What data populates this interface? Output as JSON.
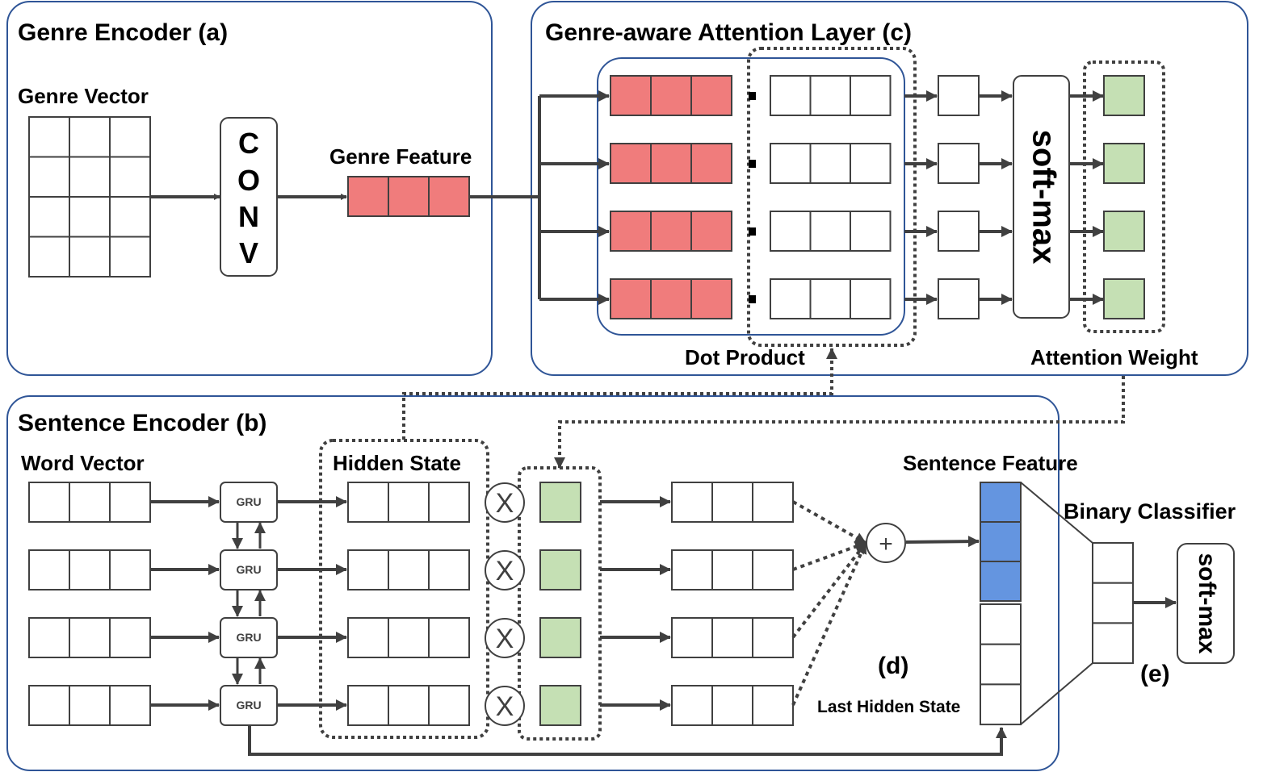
{
  "colors": {
    "genre": "#F07C7C",
    "attention": "#C5E0B4",
    "sentence": "#6495E0",
    "frame": "#2F5597",
    "stroke": "#404040"
  },
  "panel_a": {
    "title": "Genre Encoder (a)",
    "genre_vector": "Genre Vector",
    "conv": [
      "C",
      "O",
      "N",
      "V"
    ],
    "genre_feature": "Genre Feature"
  },
  "panel_c": {
    "title": "Genre-aware Attention Layer (c)",
    "softmax": "soft-max",
    "dot_product": "Dot Product",
    "attention_weight": "Attention Weight"
  },
  "panel_b": {
    "title": "Sentence Encoder (b)",
    "word_vector": "Word Vector",
    "gru": "GRU",
    "hidden_state": "Hidden State",
    "multiply": "X",
    "plus": "+",
    "sentence_feature": "Sentence Feature",
    "label_d": "(d)",
    "last_hidden_state": "Last Hidden State",
    "binary_classifier": "Binary Classifier",
    "softmax": "soft-max",
    "label_e": "(e)"
  }
}
